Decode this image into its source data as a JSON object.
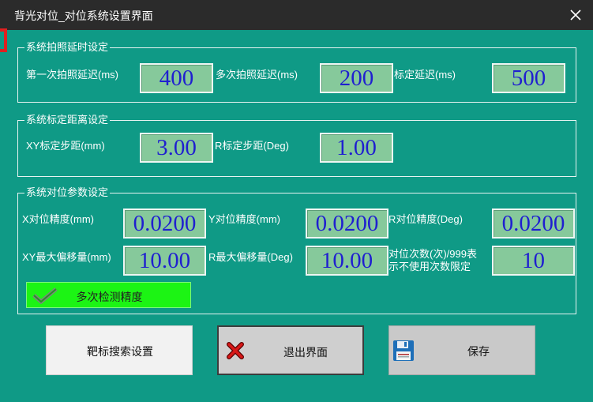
{
  "window": {
    "title": "背光对位_对位系统设置界面",
    "close_icon": "close-icon"
  },
  "photo_delay": {
    "legend": "系统拍照延时设定",
    "first_label": "第一次拍照延迟(ms)",
    "first_value": "400",
    "multi_label": "多次拍照延迟(ms)",
    "multi_value": "200",
    "calib_label": "标定延迟(ms)",
    "calib_value": "500"
  },
  "calib_distance": {
    "legend": "系统标定距离设定",
    "xy_label": "XY标定步距(mm)",
    "xy_value": "3.00",
    "r_label": "R标定步距(Deg)",
    "r_value": "1.00"
  },
  "align_params": {
    "legend": "系统对位参数设定",
    "x_prec_label": "X对位精度(mm)",
    "x_prec_value": "0.0200",
    "y_prec_label": "Y对位精度(mm)",
    "y_prec_value": "0.0200",
    "r_prec_label": "R对位精度(Deg)",
    "r_prec_value": "0.0200",
    "xy_offset_label": "XY最大偏移量(mm)",
    "xy_offset_value": "10.00",
    "r_offset_label": "R最大偏移量(Deg)",
    "r_offset_value": "10.00",
    "count_label_1": "对位次数(次)/999表",
    "count_label_2": "示不使用次数限定",
    "count_value": "10",
    "multi_check": {
      "label": "多次检测精度",
      "checked": true,
      "color": "#1cf414"
    }
  },
  "buttons": {
    "target_search": "靶标搜索设置",
    "exit": "退出界面",
    "save": "保存"
  },
  "colors": {
    "background": "#0f9a86",
    "value_bg": "#86c99b",
    "value_text": "#1f1fd0"
  }
}
